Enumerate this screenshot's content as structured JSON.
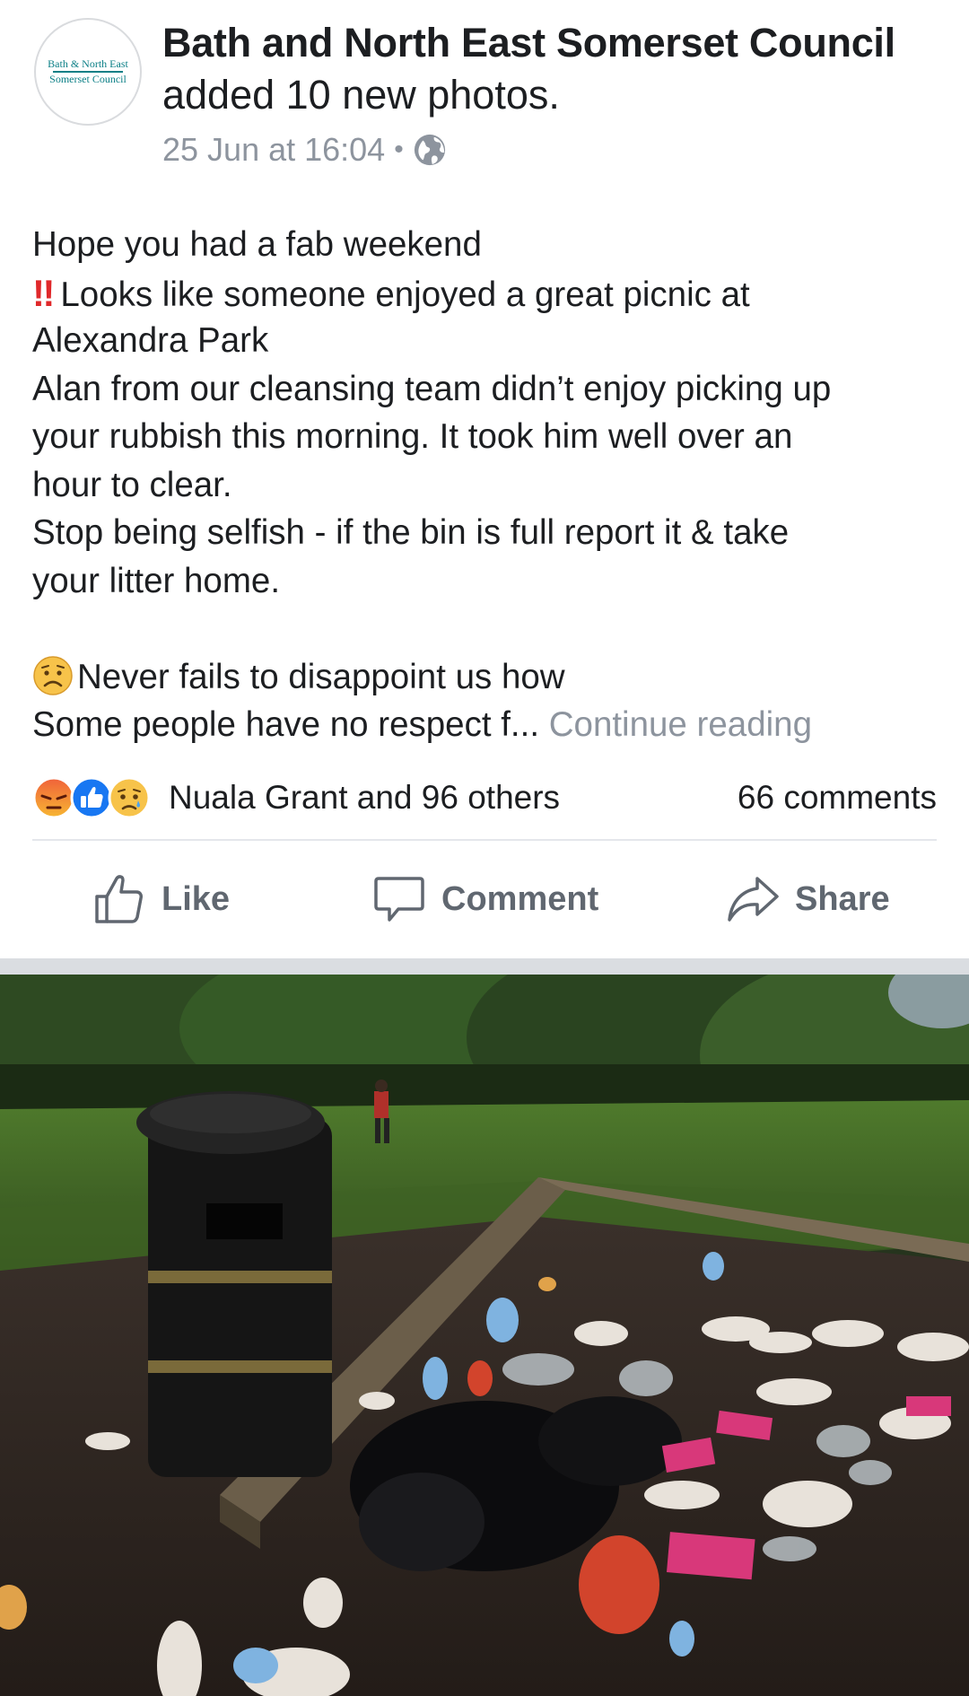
{
  "post": {
    "page_name": "Bath and North East Somerset Council",
    "action_text": "added 10 new photos.",
    "timestamp": "25 Jun at 16:04",
    "separator": "•",
    "privacy_icon": "globe-icon",
    "avatar": {
      "logo_line1": "Bath & North East",
      "logo_line2": "Somerset Council",
      "logo_color": "#0b7f86"
    },
    "body_lines": [
      "Hope you had a fab weekend",
      "Looks like someone enjoyed a great picnic at",
      "Alexandra Park",
      "Alan from our cleansing team didn’t enjoy picking up",
      "your rubbish this morning. It took him well over an",
      "hour to clear.",
      "Stop being selfish -  if the bin is full report it & take",
      "your litter home.",
      "",
      "Never fails to disappoint us how",
      "Some people have no respect f..."
    ],
    "double_exclamation": "‼",
    "continue_label": "Continue reading"
  },
  "engagement": {
    "reaction_icons": [
      "angry-reaction-icon",
      "like-reaction-icon",
      "sad-reaction-icon"
    ],
    "reactors_text": "Nuala Grant and 96 others",
    "comments_text": "66 comments"
  },
  "actions": {
    "like_label": "Like",
    "comment_label": "Comment",
    "share_label": "Share"
  },
  "colors": {
    "text": "#1c1e21",
    "secondary_text": "#8d949e",
    "action_text": "#606770",
    "like_blue": "#1877f2",
    "angry_orange": "#f0613a",
    "sad_yellow": "#f7c34a"
  }
}
